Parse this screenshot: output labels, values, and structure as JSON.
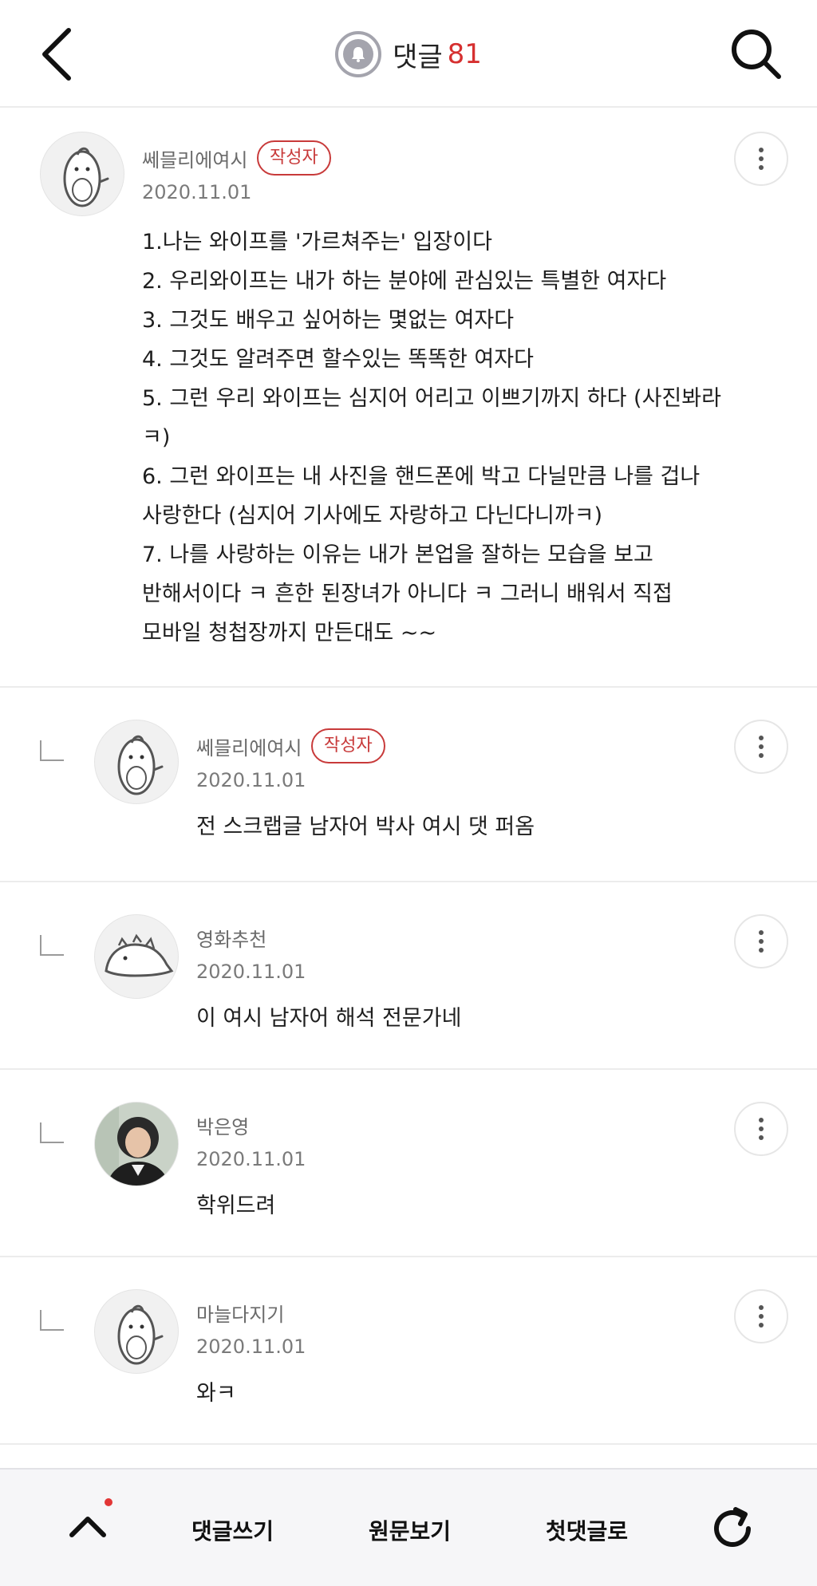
{
  "header": {
    "title": "댓글",
    "count": "81",
    "count_color": "#d63030",
    "icons": [
      "back-arrow-icon",
      "bell-icon",
      "search-icon"
    ]
  },
  "comments": [
    {
      "author": "쎄믈리에여시",
      "badge": "작성자",
      "date": "2020.11.01",
      "text": "1.나는 와이프를 '가르쳐주는' 입장이다\n2. 우리와이프는 내가 하는 분야에 관심있는 특별한 여자다\n3. 그것도 배우고 싶어하는 몇없는 여자다\n4. 그것도 알려주면 할수있는 똑똑한 여자다\n5. 그런 우리 와이프는 심지어 어리고 이쁘기까지 하다 (사진봐라\nㅋ)\n6. 그런 와이프는 내 사진을 핸드폰에 박고 다닐만큼 나를 겁나\n사랑한다 (심지어 기사에도 자랑하고 다닌다니까ㅋ)\n7. 나를 사랑하는 이유는 내가 본업을 잘하는 모습을 보고\n반해서이다 ㅋ 흔한 된장녀가 아니다 ㅋ 그러니 배워서 직접\n모바일 청첩장까지 만든대도 ~~"
    },
    {
      "author": "쎄믈리에여시",
      "badge": "작성자",
      "date": "2020.11.01",
      "text": "전 스크랩글 남자어 박사 여시 댓 퍼옴"
    },
    {
      "author": "영화추천",
      "date": "2020.11.01",
      "text": "이 여시 남자어 해석 전문가네"
    },
    {
      "author": "박은영",
      "date": "2020.11.01",
      "text": "학위드려"
    },
    {
      "author": "마늘다지기",
      "date": "2020.11.01",
      "text": "와ㅋ"
    }
  ],
  "bottom_bar": {
    "write": "댓글쓰기",
    "original": "원문보기",
    "first": "첫댓글로",
    "icons": [
      "chevron-up-icon",
      "refresh-icon"
    ]
  },
  "colors": {
    "badge": "#c83a3a",
    "divider": "#ececec",
    "notification_dot": "#e23636"
  }
}
